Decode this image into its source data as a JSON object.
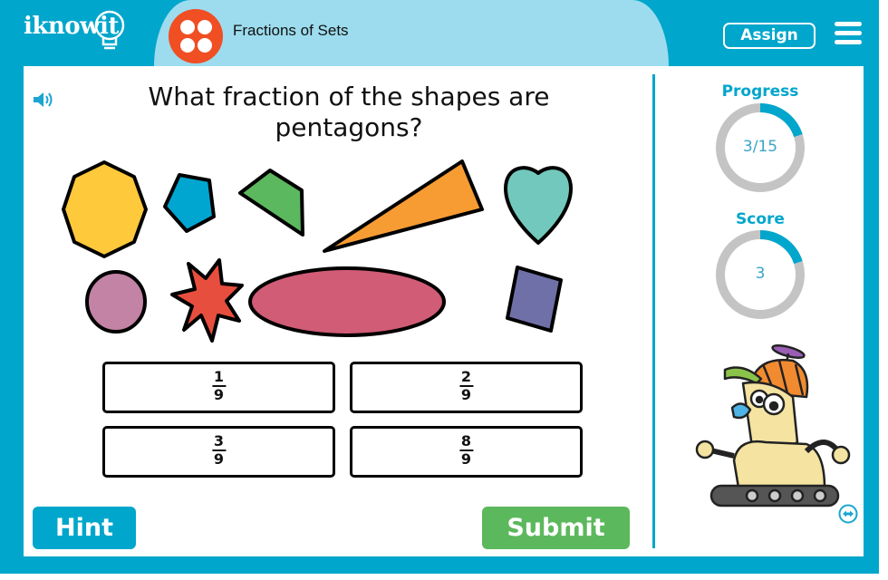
{
  "header": {
    "logo": "iknowit",
    "lesson_title": "Fractions of Sets",
    "lesson_icon": "four-dots-icon",
    "assign_label": "Assign",
    "menu_icon": "hamburger-menu-icon"
  },
  "question": {
    "speaker_icon": "speaker-icon",
    "text": "What fraction of the shapes are pentagons?",
    "shapes": [
      {
        "type": "octagon",
        "color": "#fec93a"
      },
      {
        "type": "pentagon",
        "color": "#00a6d0"
      },
      {
        "type": "trapezoid",
        "color": "#5cb85e"
      },
      {
        "type": "triangle",
        "color": "#f79c33"
      },
      {
        "type": "heart",
        "color": "#72c8bc"
      },
      {
        "type": "circle",
        "color": "#c383a4"
      },
      {
        "type": "star",
        "color": "#e84e3e"
      },
      {
        "type": "oval",
        "color": "#d15c76"
      },
      {
        "type": "square",
        "color": "#7070a8"
      }
    ]
  },
  "answers": [
    {
      "numerator": "1",
      "denominator": "9"
    },
    {
      "numerator": "2",
      "denominator": "9"
    },
    {
      "numerator": "3",
      "denominator": "9"
    },
    {
      "numerator": "8",
      "denominator": "9"
    }
  ],
  "buttons": {
    "hint": "Hint",
    "submit": "Submit"
  },
  "sidebar": {
    "progress_label": "Progress",
    "progress_text": "3/15",
    "progress_fraction": 0.2,
    "score_label": "Score",
    "score_text": "3",
    "score_fraction": 0.2,
    "expand_icon": "expand-arrows-icon"
  },
  "colors": {
    "brand": "#00a6cc",
    "tab": "#9cdcee",
    "submit": "#5cb85c",
    "ring_track": "#c4c4c4",
    "ring_fill": "#00a6cc"
  }
}
